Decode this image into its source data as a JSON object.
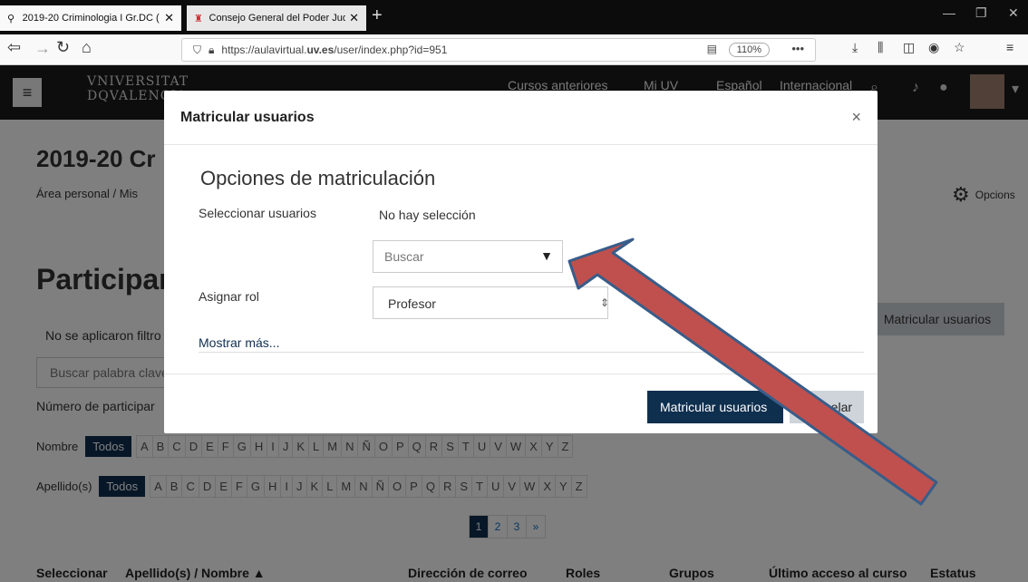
{
  "browser": {
    "tabs": [
      {
        "title": "2019-20 Criminologia I Gr.DC (",
        "active": true
      },
      {
        "title": "Consejo General del Poder Judi",
        "active": false
      }
    ],
    "new_tab": "+",
    "url_prefix": "https://aulavirtual.",
    "url_domain": "uv.es",
    "url_path": "/user/index.php?id=951",
    "zoom": "110%",
    "more": "•••"
  },
  "header": {
    "logo_line1": "VNIVERSITAT",
    "logo_line2": "DQVALENCIA",
    "nav": [
      "Cursos anteriores",
      "Mi UV",
      "Español",
      "Internacional"
    ]
  },
  "page": {
    "course_title": "2019-20 Cr",
    "breadcrumb": "Área personal / Mis",
    "options_label": "Opcions",
    "participants_title": "Participar",
    "no_filters": "No se aplicaron filtro",
    "enrol_button": "Matricular usuarios",
    "search_placeholder": "Buscar palabra clave",
    "num_participants": "Número de participar",
    "name_label": "Nombre",
    "surname_label": "Apellido(s)",
    "all_label": "Todos",
    "letters": [
      "A",
      "B",
      "C",
      "D",
      "E",
      "F",
      "G",
      "H",
      "I",
      "J",
      "K",
      "L",
      "M",
      "N",
      "Ñ",
      "O",
      "P",
      "Q",
      "R",
      "S",
      "T",
      "U",
      "V",
      "W",
      "X",
      "Y",
      "Z"
    ],
    "pages": [
      "1",
      "2",
      "3",
      "»"
    ],
    "table_headers": [
      "Seleccionar",
      "Apellido(s) / Nombre ▲",
      "Dirección de correo",
      "Roles",
      "Grupos",
      "Último acceso al curso",
      "Estatus"
    ]
  },
  "modal": {
    "title": "Matricular usuarios",
    "close": "×",
    "section_title": "Opciones de matriculación",
    "select_users_label": "Seleccionar usuarios",
    "no_selection": "No hay selección",
    "search_placeholder": "Buscar",
    "assign_role_label": "Asignar rol",
    "role_value": "Profesor",
    "show_more": "Mostrar más...",
    "primary_button": "Matricular usuarios",
    "cancel_button": "Cancelar"
  },
  "colors": {
    "primary": "#0f2f4f",
    "arrow_fill": "#c0504d",
    "arrow_stroke": "#385d8a"
  }
}
